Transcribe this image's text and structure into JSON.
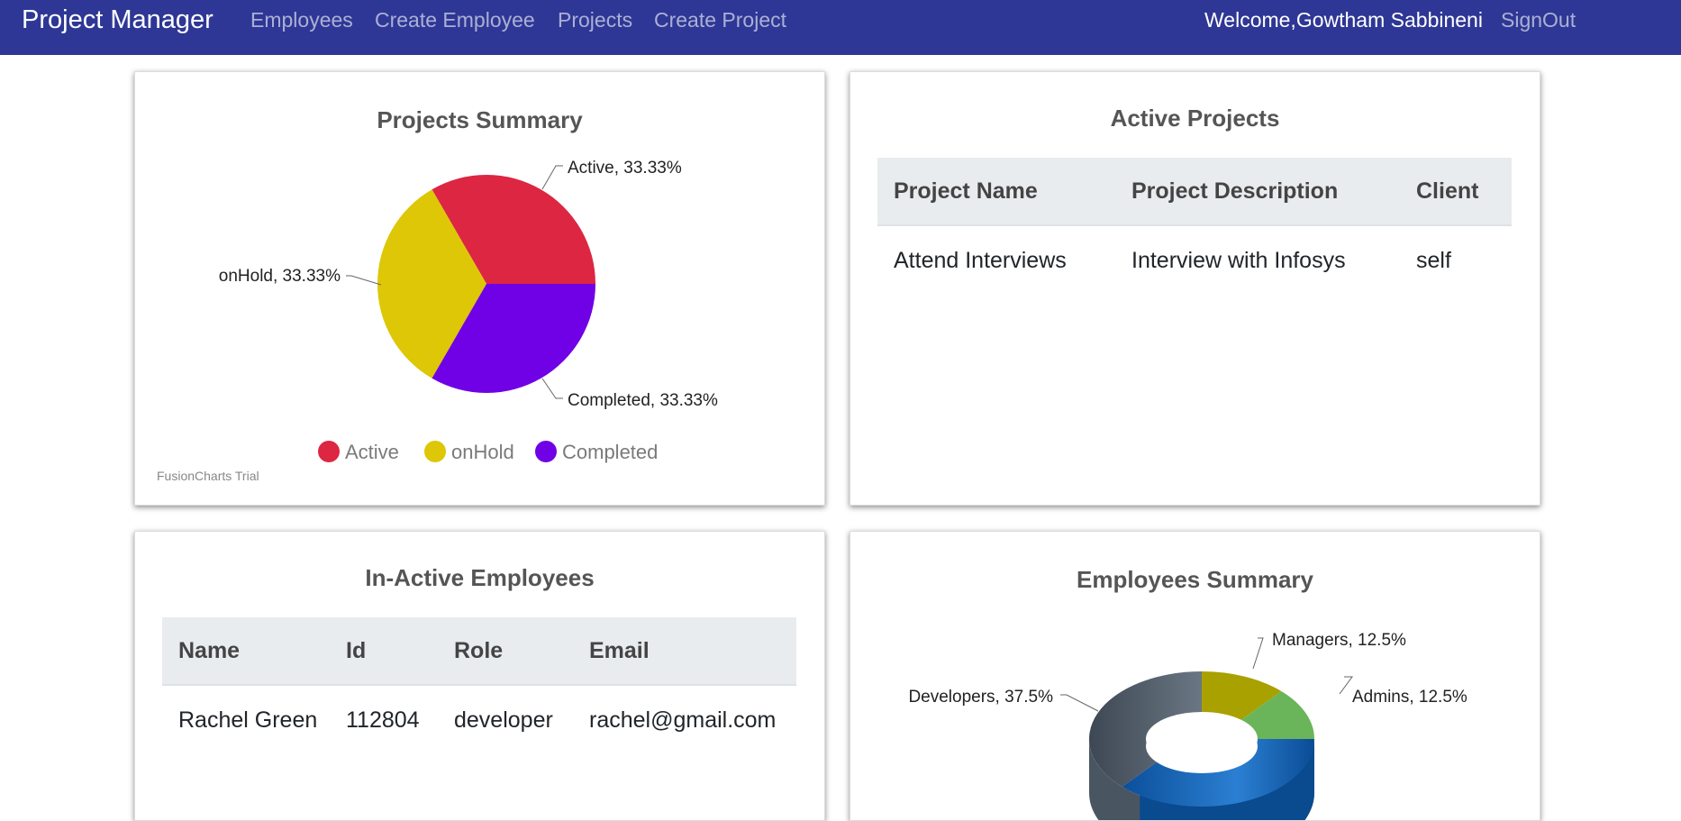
{
  "navbar": {
    "brand": "Project Manager",
    "links": [
      "Employees",
      "Create Employee",
      "Projects",
      "Create Project"
    ],
    "welcome": "Welcome,Gowtham Sabbineni",
    "signout": "SignOut"
  },
  "projects_summary": {
    "title": "Projects Summary",
    "labels": [
      "Active, 33.33%",
      "onHold, 33.33%",
      "Completed, 33.33%"
    ],
    "legend": [
      "Active",
      "onHold",
      "Completed"
    ],
    "watermark": "FusionCharts Trial"
  },
  "active_projects": {
    "title": "Active Projects",
    "headers": [
      "Project Name",
      "Project Description",
      "Client"
    ],
    "rows": [
      [
        "Attend Interviews",
        "Interview with Infosys",
        "self"
      ]
    ]
  },
  "inactive_employees": {
    "title": "In-Active Employees",
    "headers": [
      "Name",
      "Id",
      "Role",
      "Email"
    ],
    "rows": [
      [
        "Rachel Green",
        "112804",
        "developer",
        "rachel@gmail.com"
      ]
    ]
  },
  "employees_summary": {
    "title": "Employees Summary",
    "labels": [
      "Managers, 12.5%",
      "Admins, 12.5%",
      "Developers, 37.5%"
    ]
  },
  "chart_data": [
    {
      "type": "pie",
      "title": "Projects Summary",
      "categories": [
        "Active",
        "onHold",
        "Completed"
      ],
      "values": [
        33.33,
        33.33,
        33.33
      ],
      "colors": [
        "#dc2642",
        "#ddc707",
        "#7000e6"
      ],
      "legend": "bottom"
    },
    {
      "type": "pie",
      "title": "Employees Summary",
      "categories": [
        "Managers",
        "Admins",
        "Developers"
      ],
      "values": [
        12.5,
        12.5,
        37.5
      ],
      "colors": [
        "#a8a100",
        "#6ab55a",
        "#566270"
      ]
    }
  ]
}
